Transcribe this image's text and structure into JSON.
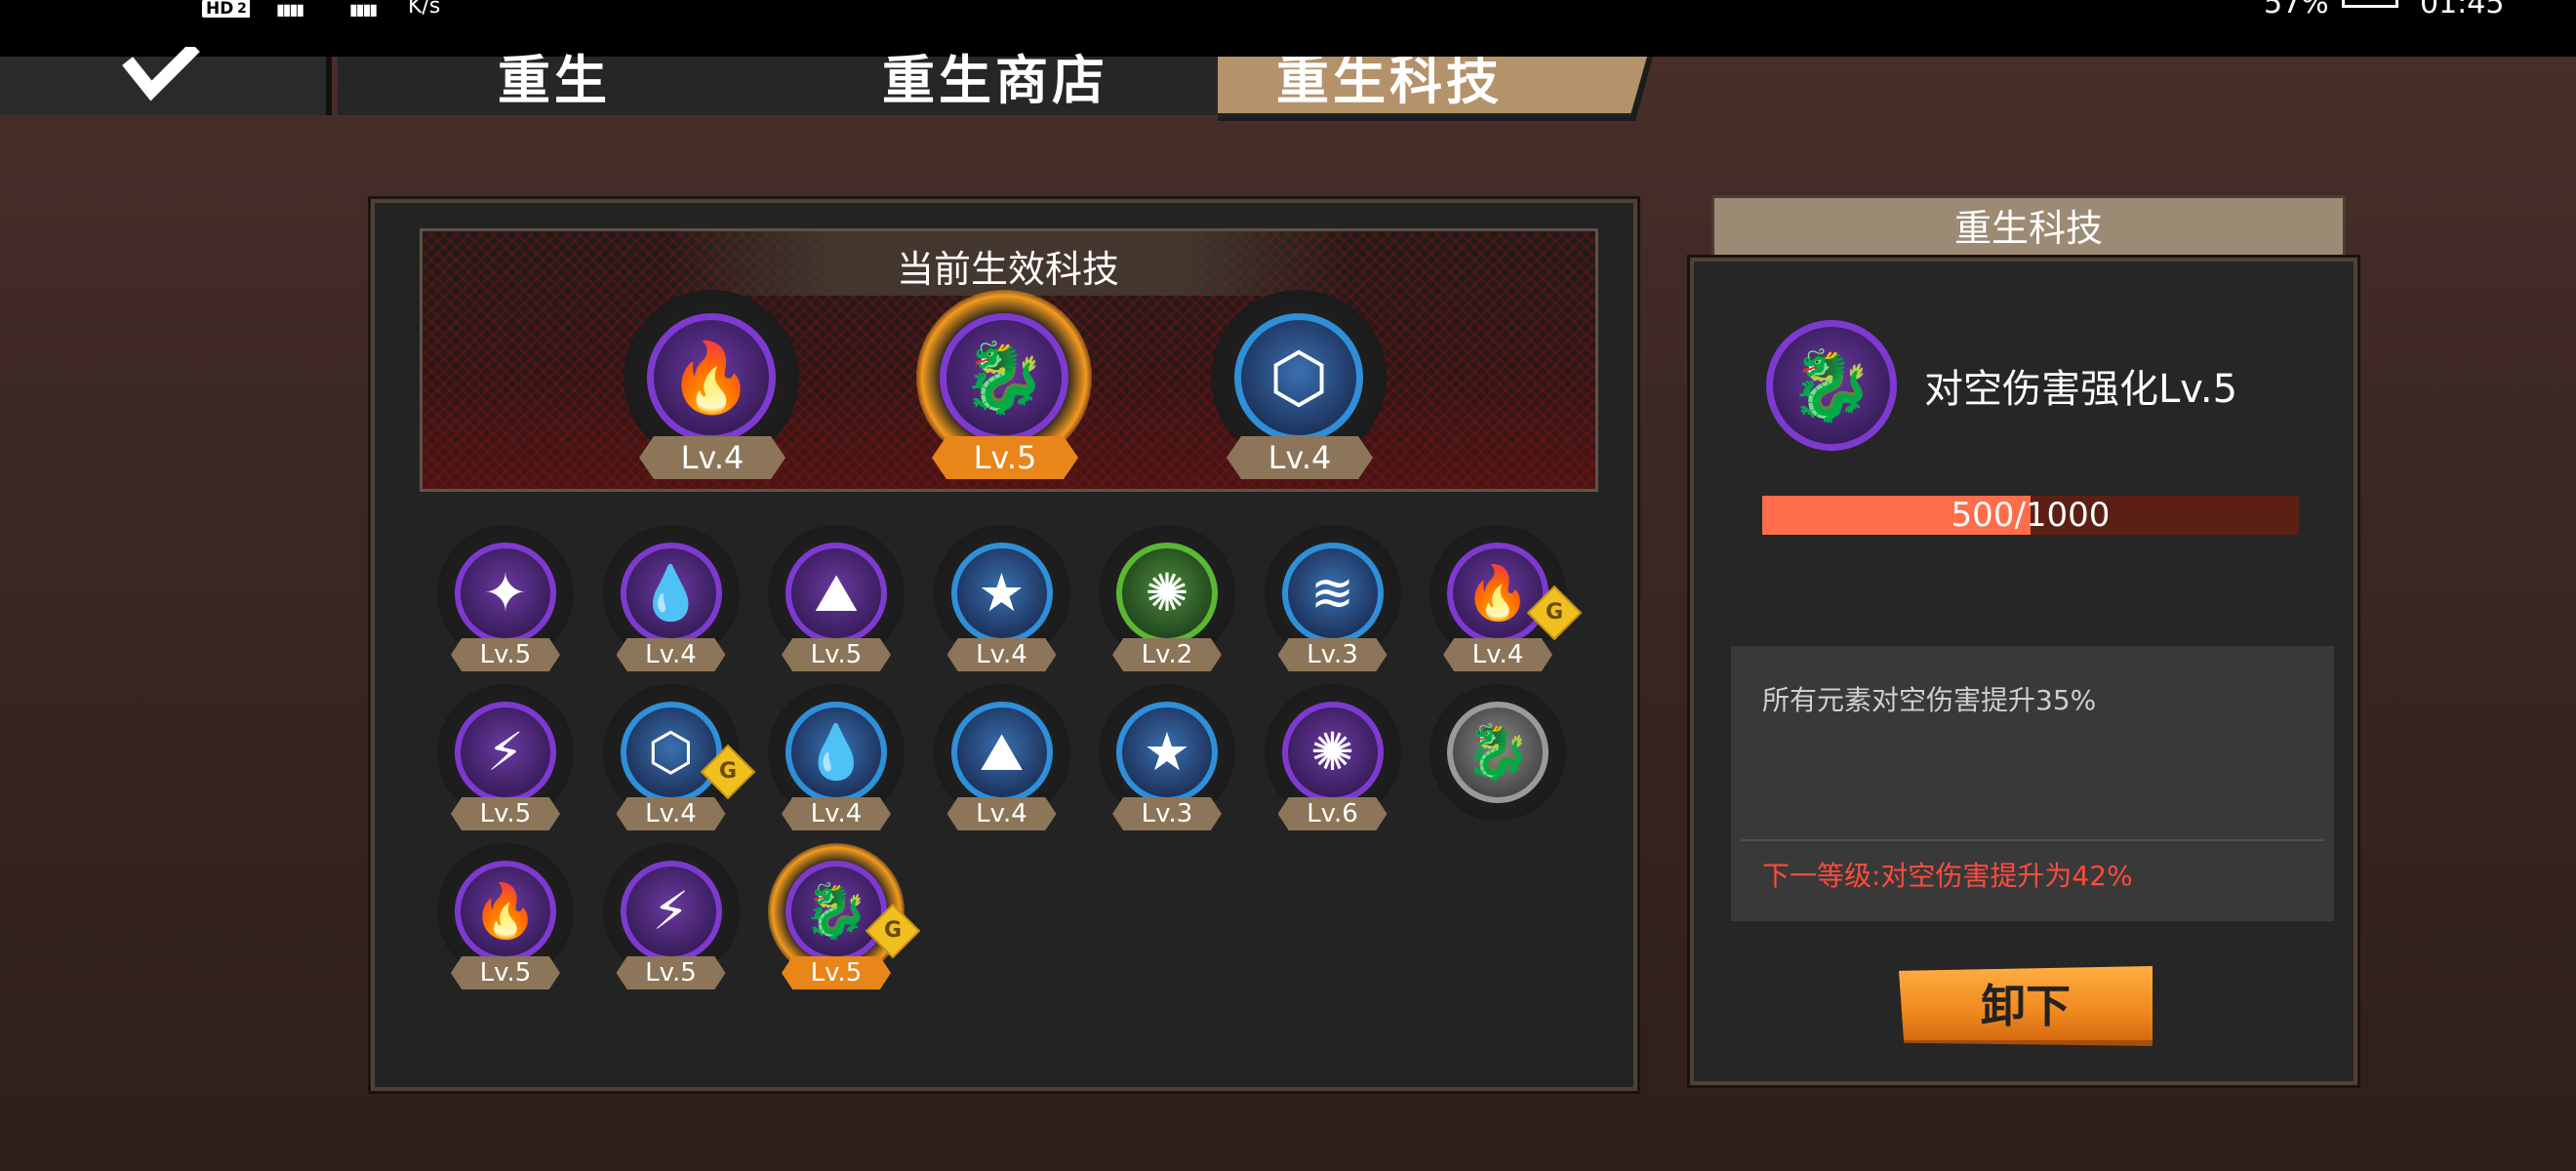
{
  "status_bar": {
    "hd_label": "HD",
    "sim_slot": "2",
    "speed_unit": "K/s",
    "battery_pct": "57%",
    "time": "01:45"
  },
  "tabs": [
    {
      "label": "重生",
      "active": false
    },
    {
      "label": "重生商店",
      "active": false
    },
    {
      "label": "重生科技",
      "active": true
    }
  ],
  "active_section": {
    "title": "当前生效科技",
    "slots": [
      {
        "icon": "fire-icon",
        "ring": "purple",
        "level": "Lv.4",
        "selected": false
      },
      {
        "icon": "lightning-dragon-icon",
        "ring": "purple",
        "level": "Lv.5",
        "selected": true
      },
      {
        "icon": "void-ring-icon",
        "ring": "blue",
        "level": "Lv.4",
        "selected": false
      }
    ]
  },
  "tech_grid": [
    {
      "icon": "light-crystal-icon",
      "ring": "purple",
      "level": "Lv.5"
    },
    {
      "icon": "water-drop-icon",
      "ring": "purple",
      "level": "Lv.4"
    },
    {
      "icon": "earth-rock-icon",
      "ring": "purple",
      "level": "Lv.5"
    },
    {
      "icon": "gold-star-icon",
      "ring": "blue",
      "level": "Lv.4"
    },
    {
      "icon": "poison-icon",
      "ring": "green",
      "level": "Lv.2"
    },
    {
      "icon": "wind-icon",
      "ring": "blue",
      "level": "Lv.3"
    },
    {
      "icon": "fire-icon",
      "ring": "purple",
      "level": "Lv.4",
      "g_badge": true
    },
    {
      "icon": "lightning-icon",
      "ring": "purple",
      "level": "Lv.5"
    },
    {
      "icon": "void-ring-icon",
      "ring": "blue",
      "level": "Lv.4",
      "g_badge": true
    },
    {
      "icon": "water-drop-icon",
      "ring": "blue",
      "level": "Lv.4"
    },
    {
      "icon": "earth-rock-icon",
      "ring": "blue",
      "level": "Lv.4"
    },
    {
      "icon": "gold-star-icon",
      "ring": "blue",
      "level": "Lv.3"
    },
    {
      "icon": "poison-icon",
      "ring": "purple",
      "level": "Lv.6"
    },
    {
      "icon": "dragon-icon",
      "ring": "grey",
      "level": ""
    },
    {
      "icon": "fire-icon",
      "ring": "purple",
      "level": "Lv.5"
    },
    {
      "icon": "lightning-icon",
      "ring": "purple",
      "level": "Lv.5"
    },
    {
      "icon": "lightning-dragon-icon",
      "ring": "purple",
      "level": "Lv.5",
      "g_badge": true,
      "selected": true
    }
  ],
  "g_badge_label": "G",
  "detail": {
    "tab_title": "重生科技",
    "name": "对空伤害强化Lv.5",
    "progress_text": "500/1000",
    "progress_value": 0.5,
    "current_effect": "所有元素对空伤害提升35%",
    "next_effect": "下一等级:对空伤害提升为42%",
    "unequip_label": "卸下"
  },
  "colors": {
    "accent_orange": "#f08a20",
    "progress_fill": "#ff6d4a",
    "next_level_red": "#ff4b3e",
    "ring_purple": "#7e3ad0",
    "ring_blue": "#2f8fd8",
    "ring_green": "#5ab832"
  }
}
